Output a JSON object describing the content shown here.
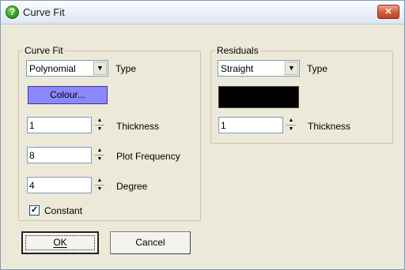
{
  "window": {
    "title": "Curve Fit",
    "app_icon_glyph": "?",
    "close_glyph": "✕"
  },
  "curve_fit": {
    "group_label": "Curve Fit",
    "type_value": "Polynomial",
    "type_label": "Type",
    "colour_label": "Colour...",
    "colour_hex": "#8b87ff",
    "thickness_value": "1",
    "thickness_label": "Thickness",
    "plot_frequency_value": "8",
    "plot_frequency_label": "Plot Frequency",
    "degree_value": "4",
    "degree_label": "Degree",
    "constant_label": "Constant",
    "constant_checked": true
  },
  "residuals": {
    "group_label": "Residuals",
    "type_value": "Straight",
    "type_label": "Type",
    "colour_hex": "#000000",
    "thickness_value": "1",
    "thickness_label": "Thickness"
  },
  "buttons": {
    "ok_label": "OK",
    "cancel_label": "Cancel"
  },
  "icons": {
    "dropdown": "chevron-down-icon",
    "spin_up": "arrow-up-icon",
    "spin_down": "arrow-down-icon",
    "check": "check-icon"
  }
}
